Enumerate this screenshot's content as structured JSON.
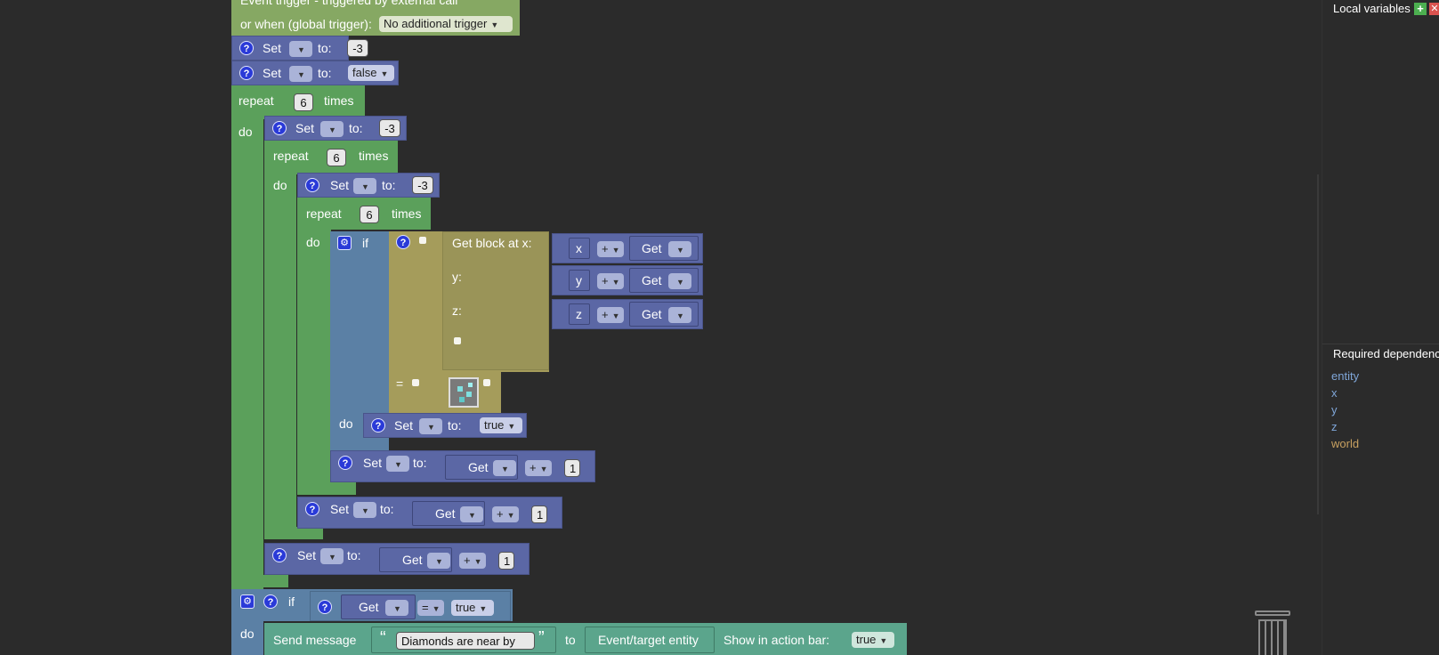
{
  "event": {
    "title": "Event trigger - triggered by external call",
    "global_trigger_label": "or when (global trigger):",
    "global_trigger_value": "No additional trigger"
  },
  "labels": {
    "set": "Set",
    "to": "to:",
    "repeat": "repeat",
    "times": "times",
    "do": "do",
    "if": "if",
    "get": "Get",
    "eq": "=",
    "plus": "+",
    "get_block_at_x": "Get block at x:",
    "y": "y:",
    "z": "z:",
    "send_message": "Send message",
    "msg_to": "to",
    "show_action_bar": "Show in action bar:"
  },
  "values": {
    "neg3": "-3",
    "false": "false",
    "six": "6",
    "one": "1",
    "true": "true",
    "x": "x",
    "y": "y",
    "z": "z"
  },
  "message": {
    "text": "Diamonds are near by",
    "open_quote": "“",
    "close_quote": "”",
    "target": "Event/target entity",
    "action_bar_value": "true"
  },
  "right_panel": {
    "local_variables": "Local variables",
    "required_dependencies": "Required dependenci",
    "dependencies": [
      "entity",
      "x",
      "y",
      "z",
      "world"
    ]
  },
  "colors": {
    "bg": "#2b2b2b",
    "green": "#5ba05b",
    "purple": "#5b67a5",
    "steel": "#5b80a5",
    "olive": "#a59c5b",
    "teal": "#5ba58c",
    "dep_blue": "#7fa6d8",
    "dep_world": "#c8a060"
  }
}
